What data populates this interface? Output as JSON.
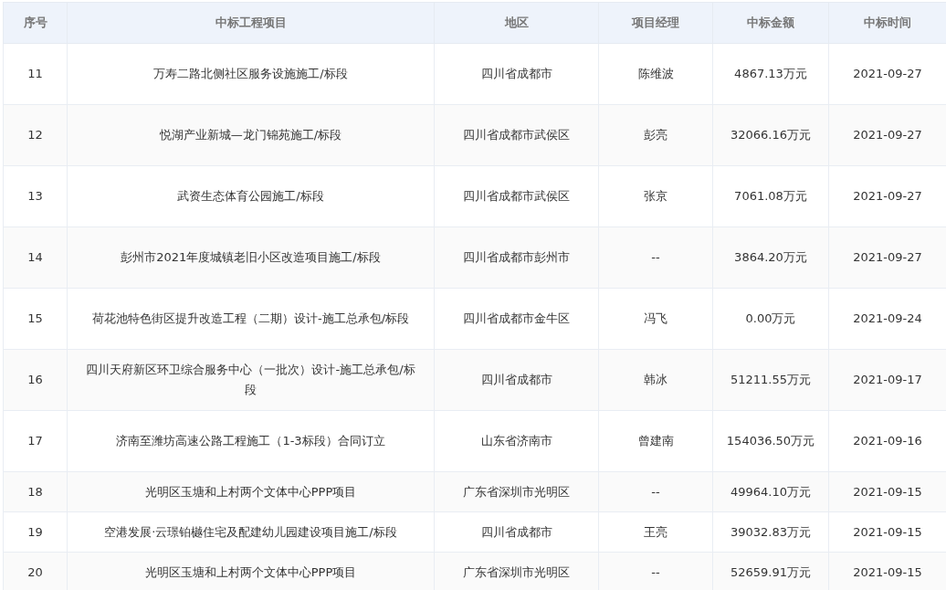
{
  "table": {
    "columns": [
      "序号",
      "中标工程项目",
      "地区",
      "项目经理",
      "中标金额",
      "中标时间"
    ],
    "rows": [
      [
        "11",
        "万寿二路北侧社区服务设施施工/标段",
        "四川省成都市",
        "陈维波",
        "4867.13万元",
        "2021-09-27"
      ],
      [
        "12",
        "悦湖产业新城—龙门锦苑施工/标段",
        "四川省成都市武侯区",
        "彭亮",
        "32066.16万元",
        "2021-09-27"
      ],
      [
        "13",
        "武资生态体育公园施工/标段",
        "四川省成都市武侯区",
        "张京",
        "7061.08万元",
        "2021-09-27"
      ],
      [
        "14",
        "彭州市2021年度城镇老旧小区改造项目施工/标段",
        "四川省成都市彭州市",
        "--",
        "3864.20万元",
        "2021-09-27"
      ],
      [
        "15",
        "荷花池特色街区提升改造工程（二期）设计-施工总承包/标段",
        "四川省成都市金牛区",
        "冯飞",
        "0.00万元",
        "2021-09-24"
      ],
      [
        "16",
        "四川天府新区环卫综合服务中心（一批次）设计-施工总承包/标段",
        "四川省成都市",
        "韩冰",
        "51211.55万元",
        "2021-09-17"
      ],
      [
        "17",
        "济南至潍坊高速公路工程施工（1-3标段）合同订立",
        "山东省济南市",
        "曾建南",
        "154036.50万元",
        "2021-09-16"
      ],
      [
        "18",
        "光明区玉塘和上村两个文体中心PPP项目",
        "广东省深圳市光明区",
        "--",
        "49964.10万元",
        "2021-09-15"
      ],
      [
        "19",
        "空港发展·云璟铂樾住宅及配建幼儿园建设项目施工/标段",
        "四川省成都市",
        "王亮",
        "39032.83万元",
        "2021-09-15"
      ],
      [
        "20",
        "光明区玉塘和上村两个文体中心PPP项目",
        "广东省深圳市光明区",
        "--",
        "52659.91万元",
        "2021-09-15"
      ]
    ]
  }
}
